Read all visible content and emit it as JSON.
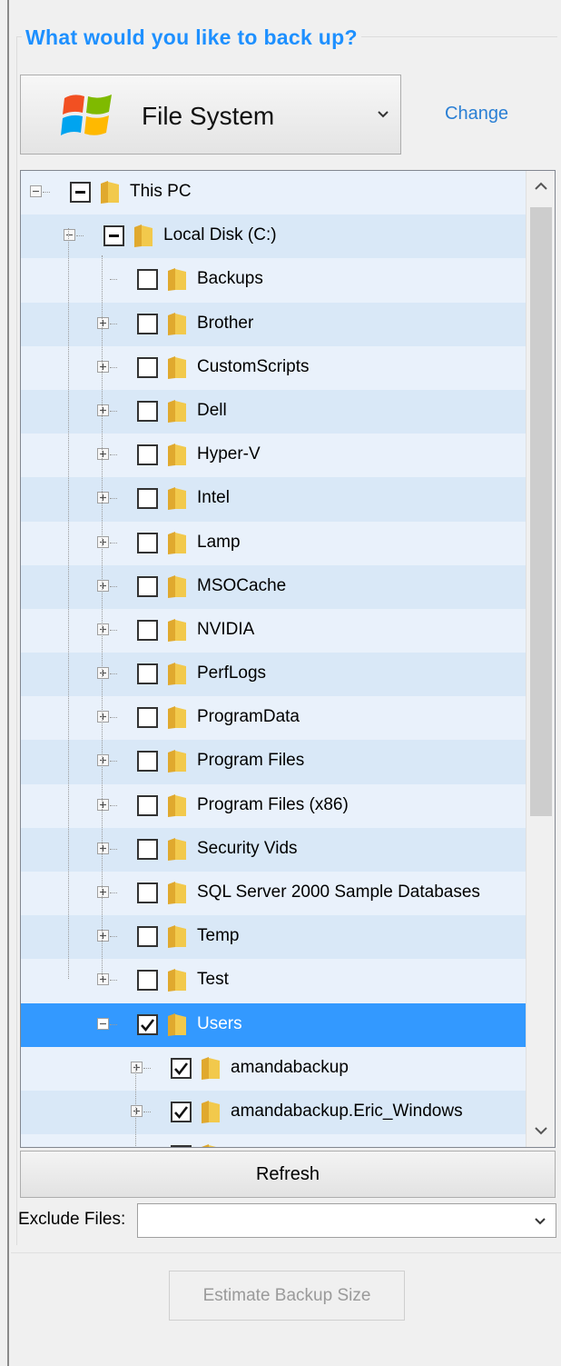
{
  "section": {
    "title": "What would you like to back up?"
  },
  "source_dropdown": {
    "selected": "File System",
    "icon": "windows-flag-icon"
  },
  "change_link": "Change",
  "tree": {
    "rows": [
      {
        "label": "This PC",
        "level": 0,
        "expander": "minus",
        "check": "partial"
      },
      {
        "label": "Local Disk (C:)",
        "level": 1,
        "expander": "minus",
        "check": "partial"
      },
      {
        "label": "Backups",
        "level": 2,
        "expander": "none",
        "check": "unchecked"
      },
      {
        "label": "Brother",
        "level": 2,
        "expander": "plus",
        "check": "unchecked"
      },
      {
        "label": "CustomScripts",
        "level": 2,
        "expander": "plus",
        "check": "unchecked"
      },
      {
        "label": "Dell",
        "level": 2,
        "expander": "plus",
        "check": "unchecked"
      },
      {
        "label": "Hyper-V",
        "level": 2,
        "expander": "plus",
        "check": "unchecked"
      },
      {
        "label": "Intel",
        "level": 2,
        "expander": "plus",
        "check": "unchecked"
      },
      {
        "label": "Lamp",
        "level": 2,
        "expander": "plus",
        "check": "unchecked"
      },
      {
        "label": "MSOCache",
        "level": 2,
        "expander": "plus",
        "check": "unchecked"
      },
      {
        "label": "NVIDIA",
        "level": 2,
        "expander": "plus",
        "check": "unchecked"
      },
      {
        "label": "PerfLogs",
        "level": 2,
        "expander": "plus",
        "check": "unchecked"
      },
      {
        "label": "ProgramData",
        "level": 2,
        "expander": "plus",
        "check": "unchecked"
      },
      {
        "label": "Program Files",
        "level": 2,
        "expander": "plus",
        "check": "unchecked"
      },
      {
        "label": "Program Files (x86)",
        "level": 2,
        "expander": "plus",
        "check": "unchecked"
      },
      {
        "label": "Security Vids",
        "level": 2,
        "expander": "plus",
        "check": "unchecked"
      },
      {
        "label": "SQL Server 2000 Sample Databases",
        "level": 2,
        "expander": "plus",
        "check": "unchecked"
      },
      {
        "label": "Temp",
        "level": 2,
        "expander": "plus",
        "check": "unchecked"
      },
      {
        "label": "Test",
        "level": 2,
        "expander": "plus",
        "check": "unchecked"
      },
      {
        "label": "Users",
        "level": 2,
        "expander": "minus",
        "check": "checked",
        "selected": true
      },
      {
        "label": "amandabackup",
        "level": 3,
        "expander": "plus",
        "check": "checked"
      },
      {
        "label": "amandabackup.Eric_Windows",
        "level": 3,
        "expander": "plus",
        "check": "checked"
      },
      {
        "label": "",
        "level": 3,
        "expander": "none",
        "check": "checked",
        "partial_cut": true
      }
    ]
  },
  "buttons": {
    "refresh": "Refresh",
    "estimate": "Estimate Backup Size"
  },
  "exclude": {
    "label": "Exclude Files:",
    "value": ""
  },
  "colors": {
    "title": "#1e90ff",
    "link": "#2a7fd4",
    "row_odd": "#e9f1fb",
    "row_even": "#d9e8f7",
    "selected": "#3399ff",
    "folder": "#f2c94c"
  }
}
